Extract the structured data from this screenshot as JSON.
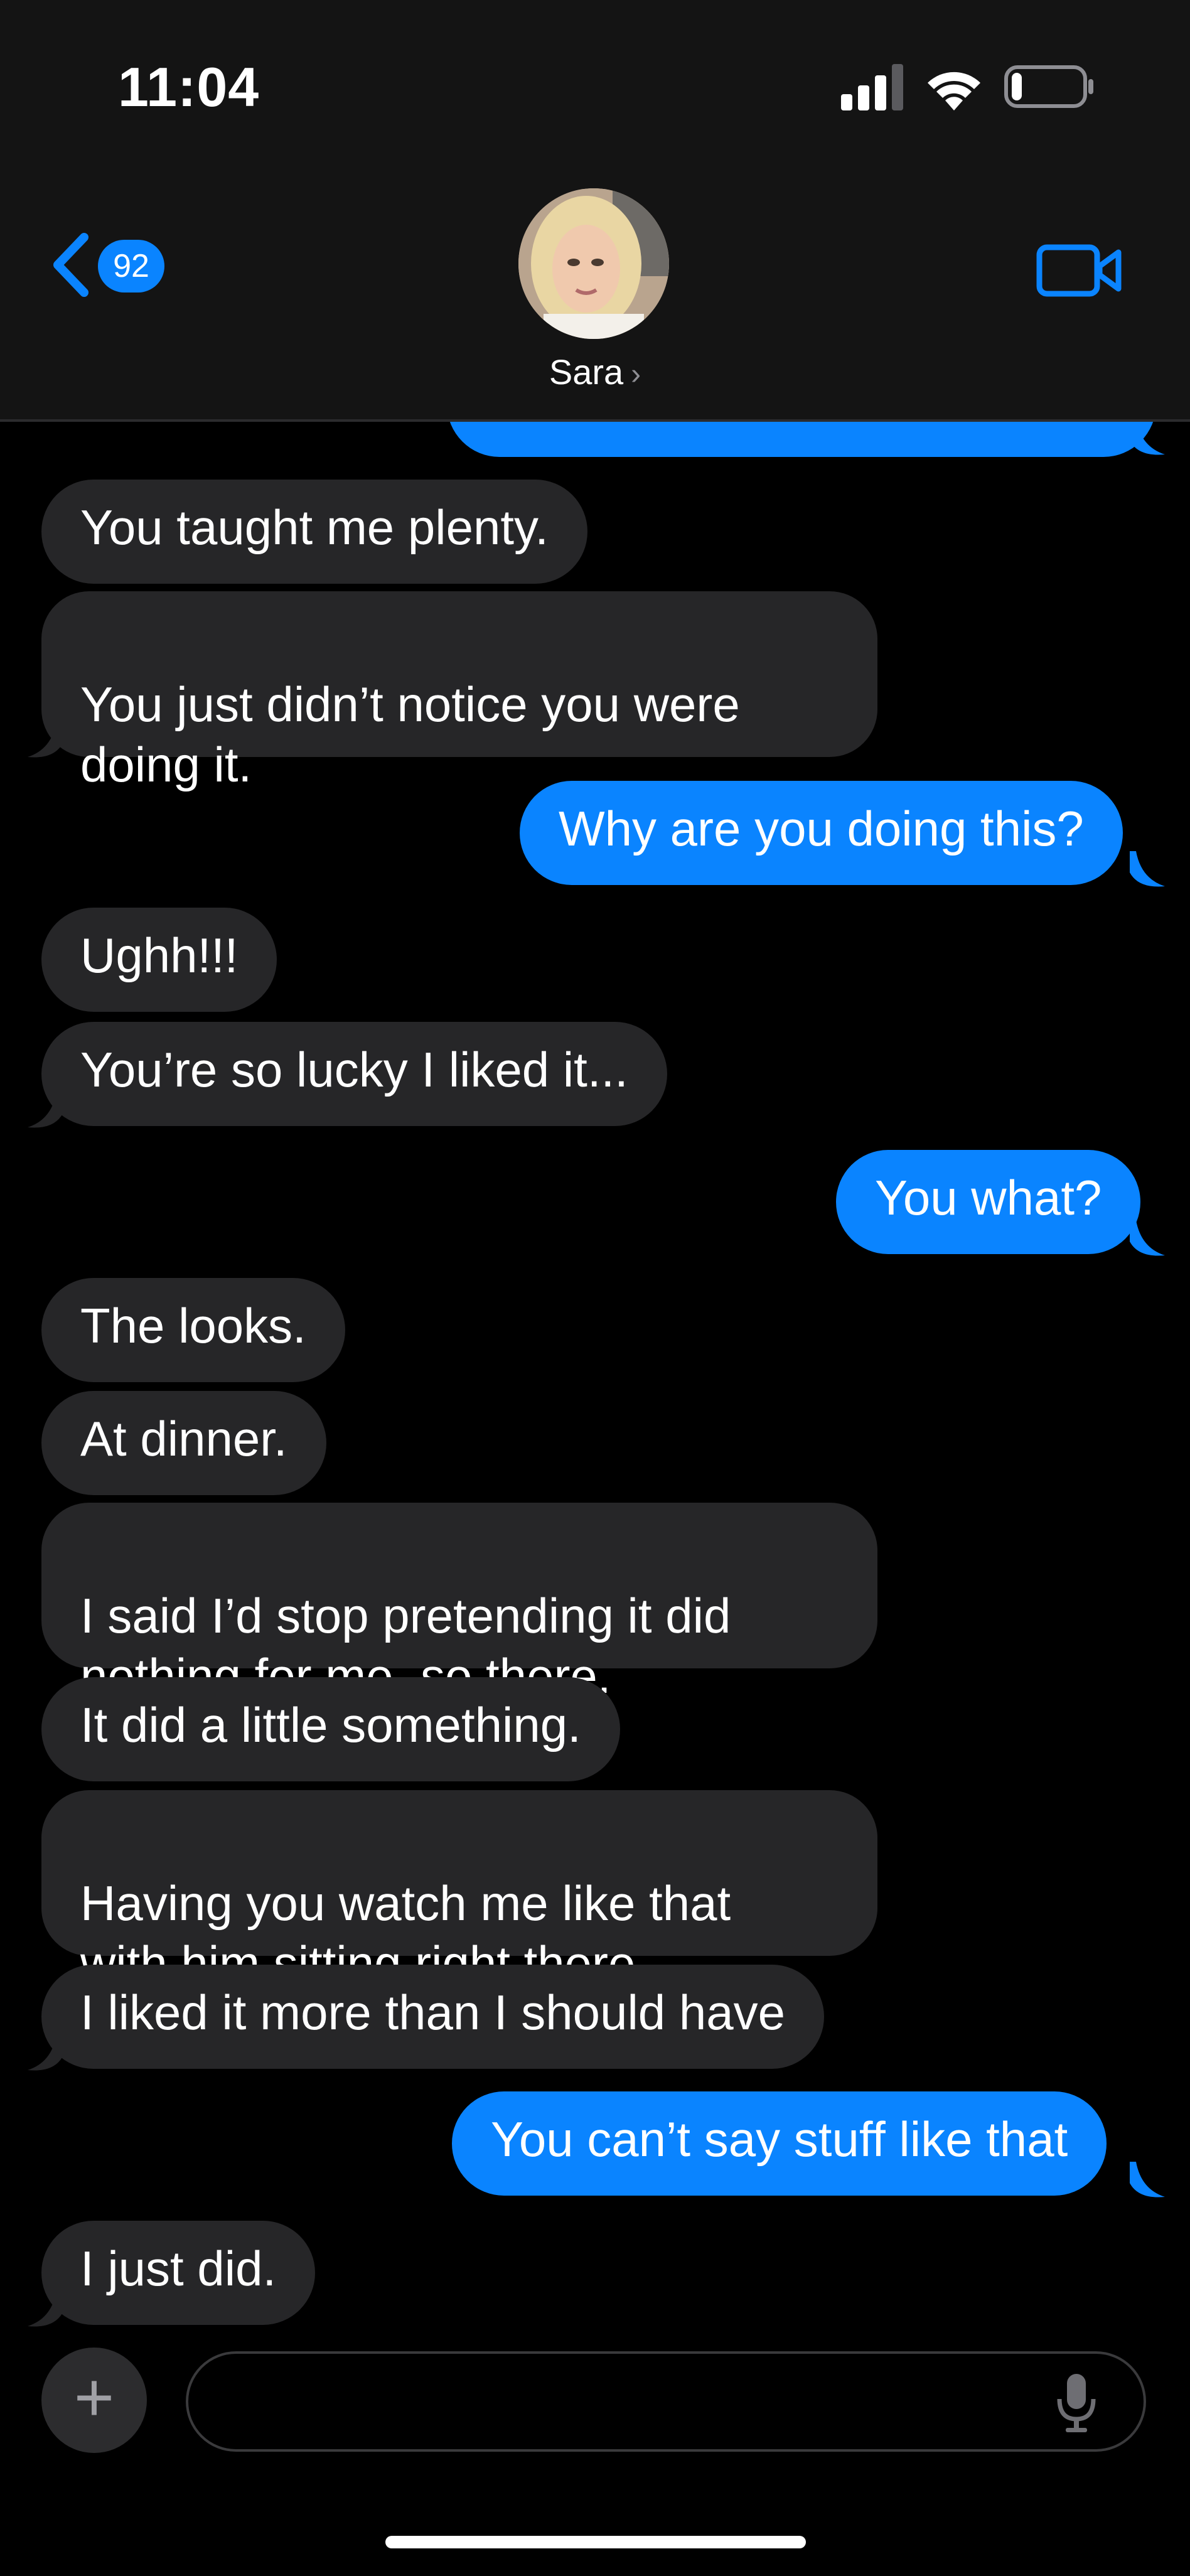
{
  "status_bar": {
    "time": "11:04",
    "battery_level": 0.15
  },
  "header": {
    "back_badge": "92",
    "contact_name": "Sara"
  },
  "messages": [
    {
      "from": "me",
      "text": ""
    },
    {
      "from": "them",
      "text": "You taught me plenty."
    },
    {
      "from": "them",
      "text": "You just didn’t notice you were\ndoing it."
    },
    {
      "from": "me",
      "text": "Why are you doing this?"
    },
    {
      "from": "them",
      "text": "Ughh!!!"
    },
    {
      "from": "them",
      "text": "You’re so lucky I liked it..."
    },
    {
      "from": "me",
      "text": "You what?"
    },
    {
      "from": "them",
      "text": "The looks."
    },
    {
      "from": "them",
      "text": "At dinner."
    },
    {
      "from": "them",
      "text": "I said I’d stop pretending it did\nnothing for me, so there."
    },
    {
      "from": "them",
      "text": "It did a little something."
    },
    {
      "from": "them",
      "text": "Having you watch me like that\nwith him sitting right there."
    },
    {
      "from": "them",
      "text": "I liked it more than I should have"
    },
    {
      "from": "me",
      "text": "You can’t say stuff like that"
    },
    {
      "from": "them",
      "text": "I just did."
    }
  ],
  "composer": {
    "placeholder": ""
  },
  "colors": {
    "accent": "#0a84ff",
    "incoming_bubble": "#262628",
    "background": "#000000"
  },
  "icons": [
    "signal-icon",
    "wifi-icon",
    "battery-icon",
    "back-chevron-icon",
    "facetime-icon",
    "plus-icon",
    "mic-icon"
  ]
}
